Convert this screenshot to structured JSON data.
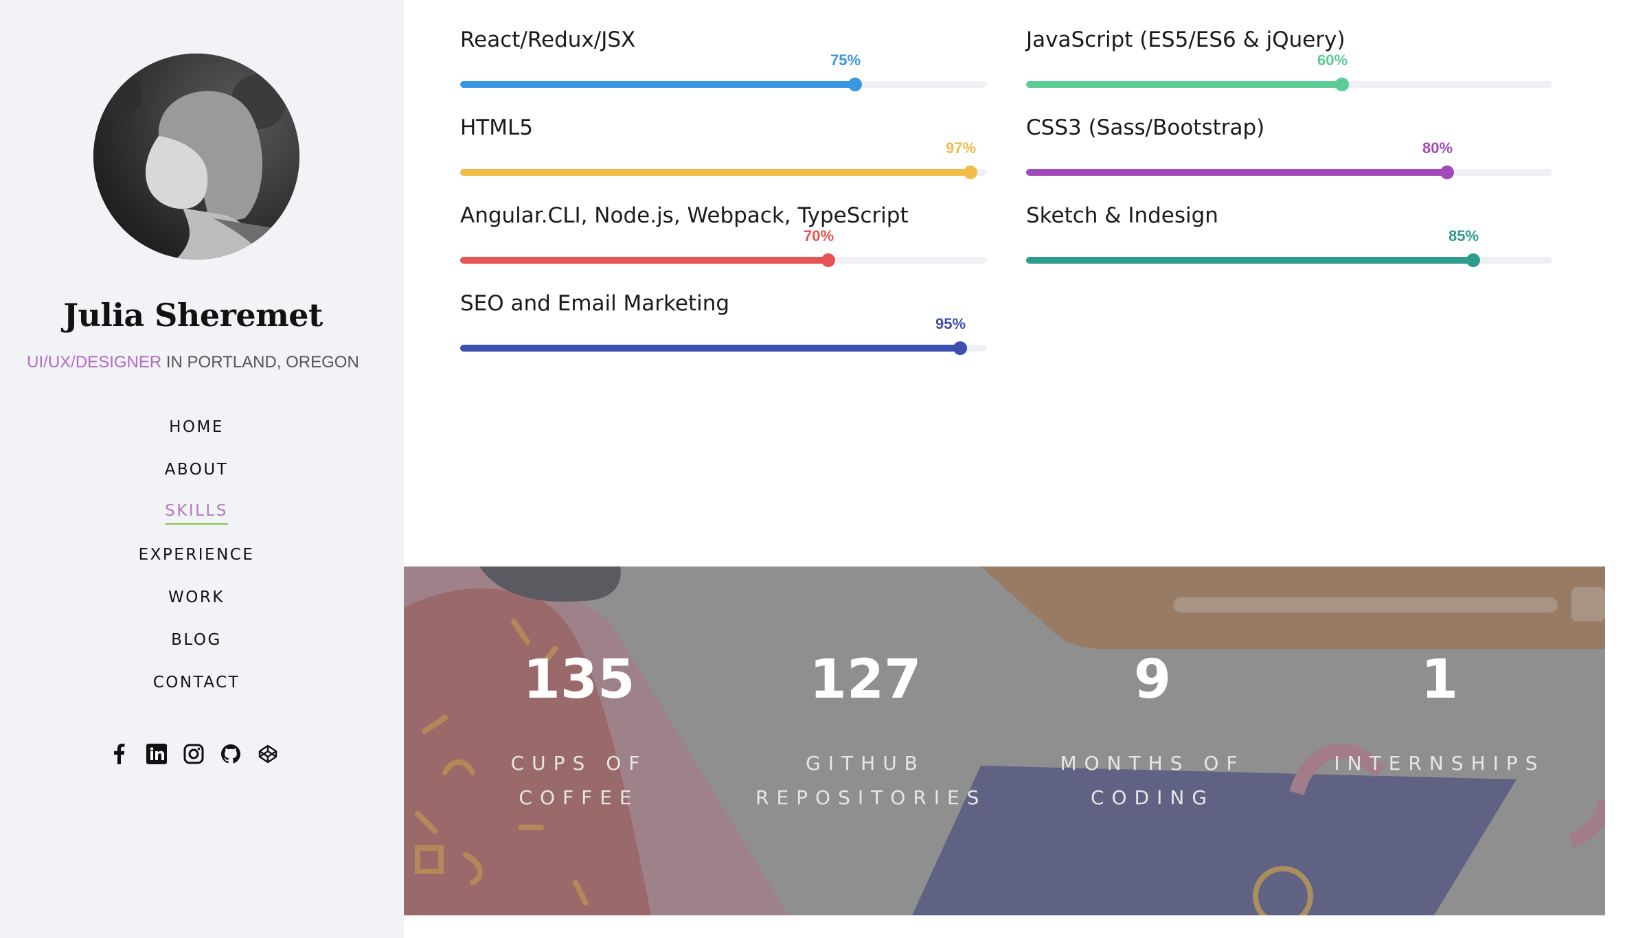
{
  "profile": {
    "name": "Julia Sheremet",
    "role_accent": "UI/UX/DESIGNER",
    "role_rest": " IN PORTLAND, OREGON"
  },
  "nav": {
    "items": [
      {
        "label": "HOME",
        "active": false
      },
      {
        "label": "ABOUT",
        "active": false
      },
      {
        "label": "SKILLS",
        "active": true
      },
      {
        "label": "EXPERIENCE",
        "active": false
      },
      {
        "label": "WORK",
        "active": false
      },
      {
        "label": "BLOG",
        "active": false
      },
      {
        "label": "CONTACT",
        "active": false
      }
    ]
  },
  "social": [
    "facebook-icon",
    "linkedin-icon",
    "instagram-icon",
    "github-icon",
    "codepen-icon"
  ],
  "skills": [
    {
      "label": "React/Redux/JSX",
      "percent_text": "75%",
      "value": 0.75,
      "color": "#3a96e0"
    },
    {
      "label": "JavaScript (ES5/ES6 & jQuery)",
      "percent_text": "60%",
      "value": 0.6,
      "color": "#5ccb96"
    },
    {
      "label": "HTML5",
      "percent_text": "97%",
      "value": 0.97,
      "color": "#f1bc4a"
    },
    {
      "label": "CSS3 (Sass/Bootstrap)",
      "percent_text": "80%",
      "value": 0.8,
      "color": "#a14bb8"
    },
    {
      "label": "Angular.CLI, Node.js, Webpack, TypeScript",
      "percent_text": "70%",
      "value": 0.7,
      "color": "#e75353"
    },
    {
      "label": "Sketch & Indesign",
      "percent_text": "85%",
      "value": 0.85,
      "color": "#2e9c8c"
    },
    {
      "label": "SEO and Email Marketing",
      "percent_text": "95%",
      "value": 0.95,
      "color": "#3f4fb0"
    }
  ],
  "stats": [
    {
      "number": "135",
      "caption": "CUPS OF COFFEE"
    },
    {
      "number": "127",
      "caption": "GITHUB REPOSITORIES"
    },
    {
      "number": "9",
      "caption": "MONTHS OF CODING"
    },
    {
      "number": "1",
      "caption": "INTERNSHIPS"
    }
  ]
}
